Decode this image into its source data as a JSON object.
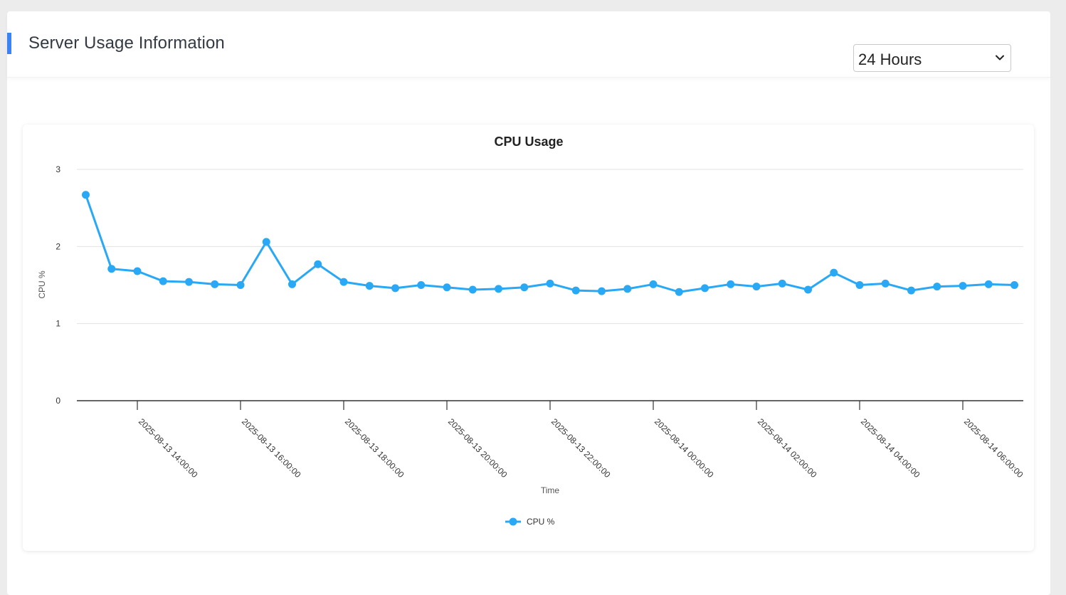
{
  "header": {
    "title": "Server Usage Information",
    "range_select": {
      "value": "24 Hours"
    }
  },
  "colors": {
    "accent": "#3b82f6",
    "series": "#29a8f5"
  },
  "chart_data": {
    "type": "line",
    "title": "CPU Usage",
    "xlabel": "Time",
    "ylabel": "CPU %",
    "ylim": [
      0,
      3
    ],
    "yticks": [
      0,
      1,
      2,
      3
    ],
    "grid": true,
    "legend_position": "bottom",
    "x_start": "2025-08-13 13:00:00",
    "x_step_minutes": 30,
    "xtick_labels": [
      "2025-08-13 14:00:00",
      "2025-08-13 16:00:00",
      "2025-08-13 18:00:00",
      "2025-08-13 20:00:00",
      "2025-08-13 22:00:00",
      "2025-08-14 00:00:00",
      "2025-08-14 02:00:00",
      "2025-08-14 04:00:00",
      "2025-08-14 06:00:00"
    ],
    "series": [
      {
        "name": "CPU %",
        "color": "#29a8f5",
        "values": [
          2.67,
          1.71,
          1.68,
          1.55,
          1.54,
          1.51,
          1.5,
          2.06,
          1.51,
          1.77,
          1.54,
          1.49,
          1.46,
          1.5,
          1.47,
          1.44,
          1.45,
          1.47,
          1.52,
          1.43,
          1.42,
          1.45,
          1.51,
          1.41,
          1.46,
          1.51,
          1.48,
          1.52,
          1.44,
          1.66,
          1.5,
          1.52,
          1.43,
          1.48,
          1.49,
          1.51,
          1.5
        ]
      }
    ]
  }
}
